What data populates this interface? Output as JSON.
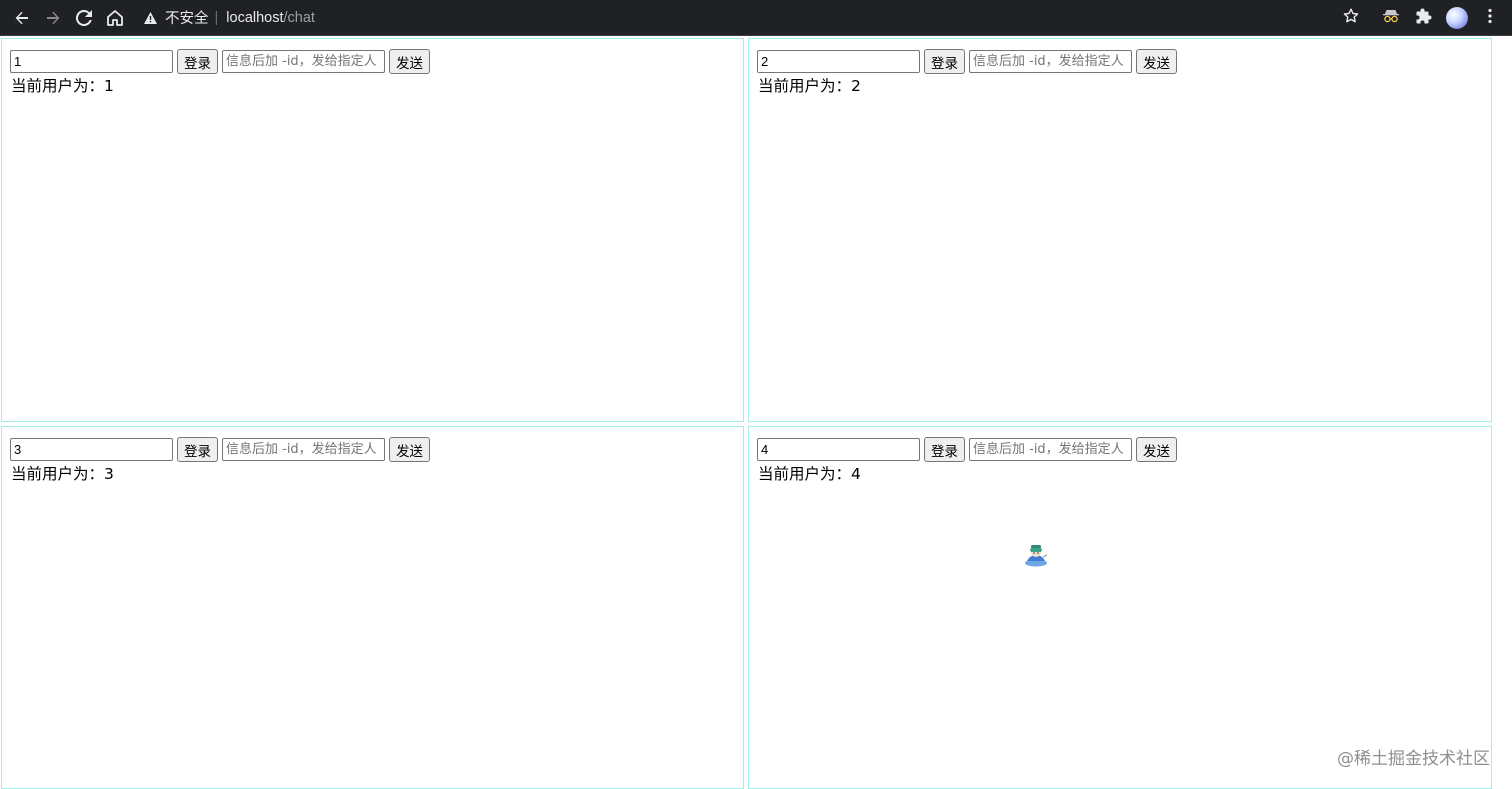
{
  "browser": {
    "security_label": "不安全",
    "url_host": "localhost",
    "url_path": "/chat",
    "icons": {
      "back": "arrow-left-icon",
      "forward": "arrow-right-icon",
      "reload": "reload-icon",
      "home": "home-icon",
      "warning": "warning-triangle-icon",
      "bookmark": "star-icon",
      "extension": "puzzle-icon",
      "profile": "avatar",
      "menu": "kebab-menu-icon"
    }
  },
  "panels": [
    {
      "user_id_value": "1",
      "login_label": "登录",
      "message_placeholder": "信息后加 -id，发给指定人",
      "send_label": "发送",
      "current_user_text": "当前用户为：1"
    },
    {
      "user_id_value": "2",
      "login_label": "登录",
      "message_placeholder": "信息后加 -id，发给指定人",
      "send_label": "发送",
      "current_user_text": "当前用户为：2"
    },
    {
      "user_id_value": "3",
      "login_label": "登录",
      "message_placeholder": "信息后加 -id，发给指定人",
      "send_label": "发送",
      "current_user_text": "当前用户为：3"
    },
    {
      "user_id_value": "4",
      "login_label": "登录",
      "message_placeholder": "信息后加 -id，发给指定人",
      "send_label": "发送",
      "current_user_text": "当前用户为：4"
    }
  ],
  "watermark": "@稀土掘金技术社区",
  "colors": {
    "panel_border": "#9ff0ea",
    "toolbar_bg": "#202124"
  }
}
